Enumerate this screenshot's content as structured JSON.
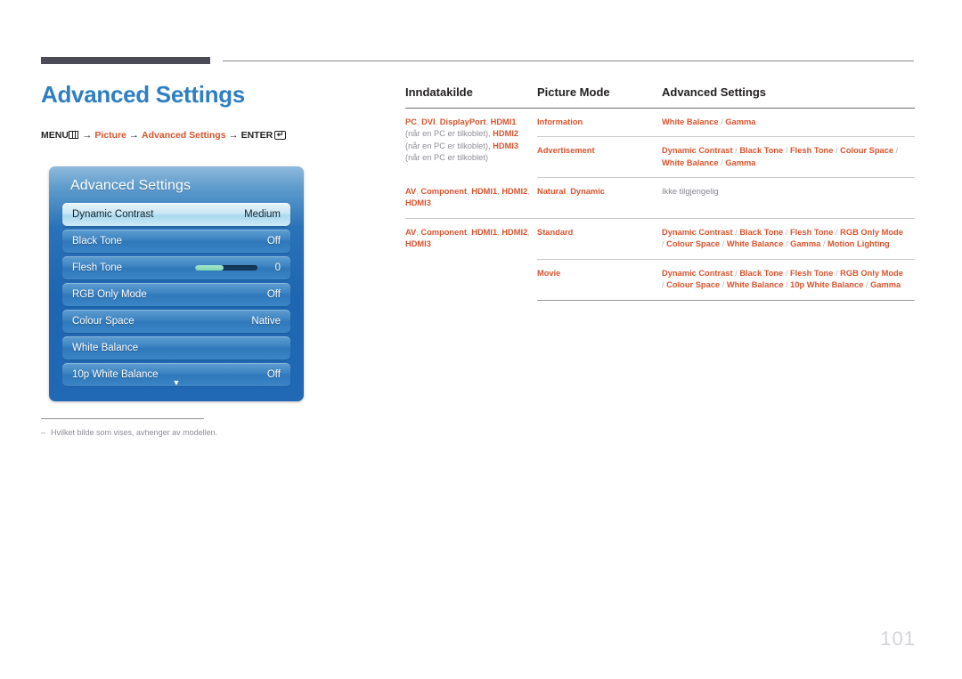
{
  "page": {
    "title": "Advanced Settings",
    "number": "101"
  },
  "breadcrumb": {
    "menu_label": "MENU",
    "menu_icon": "menu-grid-icon",
    "arrow": "→",
    "step1": "Picture",
    "step2": "Advanced Settings",
    "enter_label": "ENTER",
    "enter_icon": "enter-return-icon"
  },
  "osd": {
    "title": "Advanced Settings",
    "chevron_icon": "chevron-down-icon",
    "rows": [
      {
        "label": "Dynamic Contrast",
        "value": "Medium",
        "selected": true,
        "type": "value"
      },
      {
        "label": "Black Tone",
        "value": "Off",
        "selected": false,
        "type": "value"
      },
      {
        "label": "Flesh Tone",
        "value": "0",
        "selected": false,
        "type": "slider",
        "fill_percent": 45
      },
      {
        "label": "RGB Only Mode",
        "value": "Off",
        "selected": false,
        "type": "value"
      },
      {
        "label": "Colour Space",
        "value": "Native",
        "selected": false,
        "type": "value"
      },
      {
        "label": "White Balance",
        "value": "",
        "selected": false,
        "type": "value"
      },
      {
        "label": "10p White Balance",
        "value": "Off",
        "selected": false,
        "type": "value"
      }
    ]
  },
  "footnote": {
    "dash": "–",
    "text": "Hvilket bilde som vises, avhenger av modellen."
  },
  "table": {
    "headers": {
      "col1": "Inndatakilde",
      "col2": "Picture Mode",
      "col3": "Advanced Settings"
    },
    "rows": [
      {
        "source_parts": [
          {
            "text": "PC",
            "style": "orange"
          },
          {
            "text": ", ",
            "style": "sep"
          },
          {
            "text": "DVI",
            "style": "orange"
          },
          {
            "text": ", ",
            "style": "sep"
          },
          {
            "text": "DisplayPort",
            "style": "orange"
          },
          {
            "text": ", ",
            "style": "sep"
          },
          {
            "text": "HDMI1",
            "style": "orange"
          },
          {
            "text": " (når en PC er tilkoblet), ",
            "style": "note"
          },
          {
            "text": "HDMI2",
            "style": "orange"
          },
          {
            "text": " (når en PC er tilkoblet), ",
            "style": "note"
          },
          {
            "text": "HDMI3",
            "style": "orange"
          },
          {
            "text": " (når en PC er tilkoblet)",
            "style": "note"
          }
        ],
        "source_rowspan": 2,
        "mode": "Information",
        "settings_parts": [
          {
            "text": "White Balance",
            "style": "orange"
          },
          {
            "text": " / ",
            "style": "sep"
          },
          {
            "text": "Gamma",
            "style": "orange"
          }
        ]
      },
      {
        "mode": "Advertisement",
        "settings_parts": [
          {
            "text": "Dynamic Contrast",
            "style": "orange"
          },
          {
            "text": " / ",
            "style": "sep"
          },
          {
            "text": "Black Tone",
            "style": "orange"
          },
          {
            "text": " / ",
            "style": "sep"
          },
          {
            "text": "Flesh Tone",
            "style": "orange"
          },
          {
            "text": " / ",
            "style": "sep"
          },
          {
            "text": "Colour Space",
            "style": "orange"
          },
          {
            "text": " / ",
            "style": "sep"
          },
          {
            "text": "White Balance",
            "style": "orange"
          },
          {
            "text": " / ",
            "style": "sep"
          },
          {
            "text": "Gamma",
            "style": "orange"
          }
        ]
      },
      {
        "source_parts": [
          {
            "text": "AV",
            "style": "orange"
          },
          {
            "text": ", ",
            "style": "sep"
          },
          {
            "text": "Component",
            "style": "orange"
          },
          {
            "text": ", ",
            "style": "sep"
          },
          {
            "text": "HDMI1",
            "style": "orange"
          },
          {
            "text": ", ",
            "style": "sep"
          },
          {
            "text": "HDMI2",
            "style": "orange"
          },
          {
            "text": ", ",
            "style": "sep"
          },
          {
            "text": "HDMI3",
            "style": "orange"
          }
        ],
        "source_rowspan": 1,
        "mode_parts": [
          {
            "text": "Natural",
            "style": "orange"
          },
          {
            "text": ", ",
            "style": "sep"
          },
          {
            "text": "Dynamic",
            "style": "orange"
          }
        ],
        "settings_parts": [
          {
            "text": "Ikke tilgjengelig",
            "style": "gray"
          }
        ]
      },
      {
        "source_parts": [
          {
            "text": "AV",
            "style": "orange"
          },
          {
            "text": ", ",
            "style": "sep"
          },
          {
            "text": "Component",
            "style": "orange"
          },
          {
            "text": ", ",
            "style": "sep"
          },
          {
            "text": "HDMI1",
            "style": "orange"
          },
          {
            "text": ", ",
            "style": "sep"
          },
          {
            "text": "HDMI2",
            "style": "orange"
          },
          {
            "text": ", ",
            "style": "sep"
          },
          {
            "text": "HDMI3",
            "style": "orange"
          }
        ],
        "source_rowspan": 2,
        "mode": "Standard",
        "settings_parts": [
          {
            "text": "Dynamic Contrast",
            "style": "orange"
          },
          {
            "text": " / ",
            "style": "sep"
          },
          {
            "text": "Black Tone",
            "style": "orange"
          },
          {
            "text": " / ",
            "style": "sep"
          },
          {
            "text": "Flesh Tone",
            "style": "orange"
          },
          {
            "text": " / ",
            "style": "sep"
          },
          {
            "text": "RGB Only Mode",
            "style": "orange"
          },
          {
            "text": " / ",
            "style": "sep"
          },
          {
            "text": "Colour Space",
            "style": "orange"
          },
          {
            "text": " / ",
            "style": "sep"
          },
          {
            "text": "White Balance",
            "style": "orange"
          },
          {
            "text": " / ",
            "style": "sep"
          },
          {
            "text": "Gamma",
            "style": "orange"
          },
          {
            "text": " / ",
            "style": "sep"
          },
          {
            "text": "Motion Lighting",
            "style": "orange"
          }
        ]
      },
      {
        "mode": "Movie",
        "settings_parts": [
          {
            "text": "Dynamic Contrast",
            "style": "orange"
          },
          {
            "text": " / ",
            "style": "sep"
          },
          {
            "text": "Black Tone",
            "style": "orange"
          },
          {
            "text": " / ",
            "style": "sep"
          },
          {
            "text": "Flesh Tone",
            "style": "orange"
          },
          {
            "text": " / ",
            "style": "sep"
          },
          {
            "text": "RGB Only Mode",
            "style": "orange"
          },
          {
            "text": " / ",
            "style": "sep"
          },
          {
            "text": "Colour Space",
            "style": "orange"
          },
          {
            "text": " / ",
            "style": "sep"
          },
          {
            "text": "White Balance",
            "style": "orange"
          },
          {
            "text": " / ",
            "style": "sep"
          },
          {
            "text": "10p White Balance",
            "style": "orange"
          },
          {
            "text": " / ",
            "style": "sep"
          },
          {
            "text": "Gamma",
            "style": "orange"
          }
        ]
      }
    ]
  },
  "colors": {
    "accent_blue": "#2e7fc2",
    "accent_orange": "#d9532c",
    "rule_dark": "#4b4b58",
    "muted_gray": "#8e8e96",
    "page_number": "#d3d3da"
  }
}
